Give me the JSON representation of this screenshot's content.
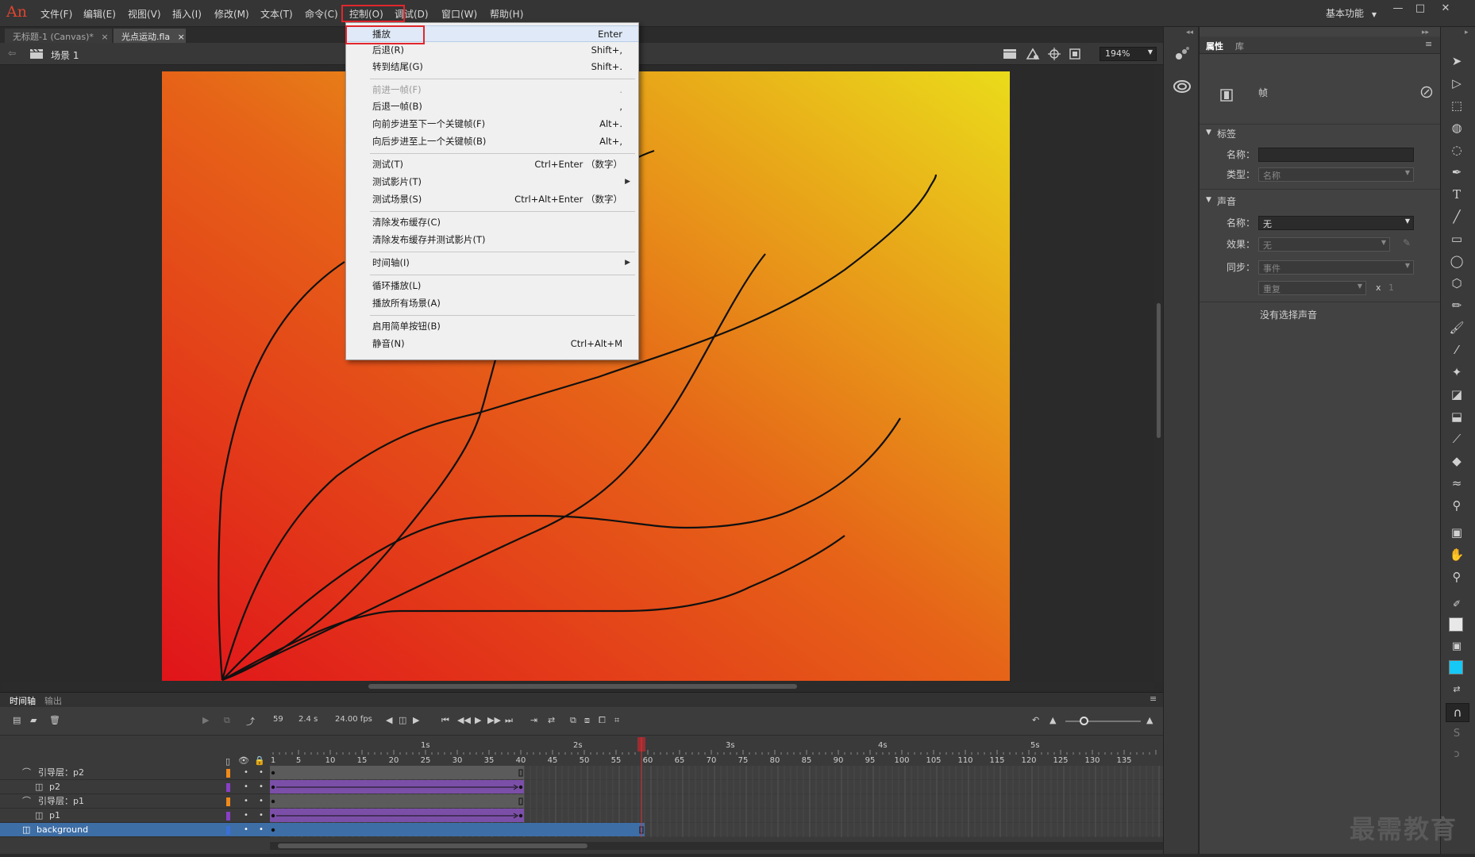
{
  "app": {
    "logo": "An"
  },
  "menubar": {
    "items": [
      "文件(F)",
      "编辑(E)",
      "视图(V)",
      "插入(I)",
      "修改(M)",
      "文本(T)",
      "命令(C)",
      "控制(O)",
      "调试(D)",
      "窗口(W)",
      "帮助(H)"
    ],
    "workspace": "基本功能",
    "minimize": "—",
    "maximize": "□",
    "close": "✕"
  },
  "tabs": [
    {
      "label": "无标题-1 (Canvas)*",
      "close": "×"
    },
    {
      "label": "光点运动.fla",
      "close": "×"
    }
  ],
  "editbar": {
    "scene": "场景 1",
    "zoom": "194%"
  },
  "control_menu": [
    {
      "label": "播放",
      "shortcut": "Enter",
      "highlighted": true
    },
    {
      "label": "后退(R)",
      "shortcut": "Shift+,"
    },
    {
      "label": "转到结尾(G)",
      "shortcut": "Shift+."
    },
    {
      "label": "前进一帧(F)",
      "shortcut": ".",
      "disabled": true
    },
    {
      "label": "后退一帧(B)",
      "shortcut": ","
    },
    {
      "label": "向前步进至下一个关键帧(F)",
      "shortcut": "Alt+."
    },
    {
      "label": "向后步进至上一个关键帧(B)",
      "shortcut": "Alt+,"
    },
    {
      "label": "测试(T)",
      "shortcut": "Ctrl+Enter （数字）"
    },
    {
      "label": "测试影片(T)",
      "shortcut": "",
      "submenu": true
    },
    {
      "label": "测试场景(S)",
      "shortcut": "Ctrl+Alt+Enter （数字）"
    },
    {
      "label": "清除发布缓存(C)",
      "shortcut": ""
    },
    {
      "label": "清除发布缓存并测试影片(T)",
      "shortcut": ""
    },
    {
      "label": "时间轴(I)",
      "shortcut": "",
      "submenu": true
    },
    {
      "label": "循环播放(L)",
      "shortcut": ""
    },
    {
      "label": "播放所有场景(A)",
      "shortcut": ""
    },
    {
      "label": "启用简单按钮(B)",
      "shortcut": ""
    },
    {
      "label": "静音(N)",
      "shortcut": "Ctrl+Alt+M"
    }
  ],
  "properties": {
    "tabs": [
      "属性",
      "库"
    ],
    "frame_label": "帧",
    "label_section": "标签",
    "name_label": "名称：",
    "type_label": "类型：",
    "type_value": "名称",
    "sound_section": "声音",
    "sound_name_label": "名称：",
    "sound_name_value": "无",
    "effect_label": "效果：",
    "effect_value": "无",
    "sync_label": "同步：",
    "sync_value": "事件",
    "repeat_value": "重复",
    "repeat_x": "x",
    "repeat_count": "1",
    "no_sound": "没有选择声音"
  },
  "timeline": {
    "tabs": [
      "时间轴",
      "输出"
    ],
    "current_frame": "59",
    "elapsed": "2.4 s",
    "fps": "24.00 fps",
    "ruler_numbers": [
      "1",
      "5",
      "10",
      "15",
      "20",
      "25",
      "30",
      "35",
      "40",
      "45",
      "50",
      "55",
      "60",
      "65",
      "70",
      "75",
      "80",
      "85",
      "90",
      "95",
      "100",
      "105",
      "110",
      "115",
      "120",
      "125",
      "130",
      "135"
    ],
    "ruler_seconds": [
      "1s",
      "2s",
      "3s",
      "4s",
      "5s"
    ],
    "playhead_frame": 59,
    "layers": [
      {
        "name": "引导层：p2",
        "type": "guide",
        "color": "#f08a1c"
      },
      {
        "name": "p2",
        "type": "guided",
        "color": "#8a3fc7"
      },
      {
        "name": "引导层：p1",
        "type": "guide",
        "color": "#f08a1c"
      },
      {
        "name": "p1",
        "type": "guided",
        "color": "#8a3fc7"
      },
      {
        "name": "background",
        "type": "normal",
        "color": "#3b6fd6"
      }
    ]
  },
  "colors": {
    "accent_red": "#e1262d",
    "selection_blue": "#3e6ea6",
    "tween_purple": "#7b4fa8",
    "stage_gradient_start": "#e0141a",
    "stage_gradient_end": "#eadb1a"
  },
  "watermark": "最需教育"
}
